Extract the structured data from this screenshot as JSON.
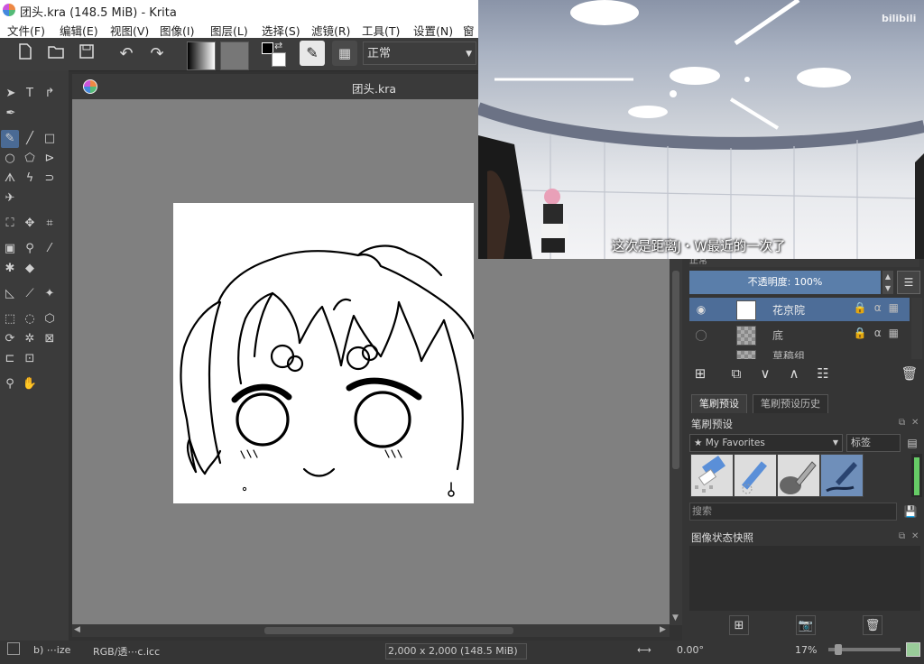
{
  "window": {
    "title": "团头.kra (148.5 MiB)  - Krita"
  },
  "menu": [
    "文件(F)",
    "编辑(E)",
    "视图(V)",
    "图像(I)",
    "图层(L)",
    "选择(S)",
    "滤镜(R)",
    "工具(T)",
    "设置(N)",
    "窗口"
  ],
  "toolbar": {
    "blend_mode": "正常"
  },
  "document": {
    "tab_title": "团头.kra"
  },
  "layers": {
    "blend_label": "正常",
    "opacity_label": "不透明度:  100%",
    "items": [
      {
        "name": "花京院",
        "selected": true
      },
      {
        "name": "底",
        "selected": false
      },
      {
        "name": "草稿组",
        "selected": false
      }
    ]
  },
  "brush_presets": {
    "tabs": [
      "笔刷预设",
      "笔刷预设历史"
    ],
    "title": "笔刷预设",
    "filter": "★ My Favorites",
    "tag_label": "标签",
    "search_placeholder": "搜索"
  },
  "snapshot": {
    "title": "图像状态快照"
  },
  "status": {
    "brush": "b) ⋯ize",
    "color_space": "RGB/透⋯c.icc",
    "dimensions": "2,000 x 2,000 (148.5 MiB)",
    "rotation": "0.00°",
    "zoom": "17%"
  },
  "video": {
    "subtitle": "这次是距离J・W最近的一次了",
    "watermark": "bilibili"
  },
  "colors": {
    "accent": "#5a7eaa",
    "canvas_bg": "#808080",
    "panel_bg": "#353535"
  }
}
